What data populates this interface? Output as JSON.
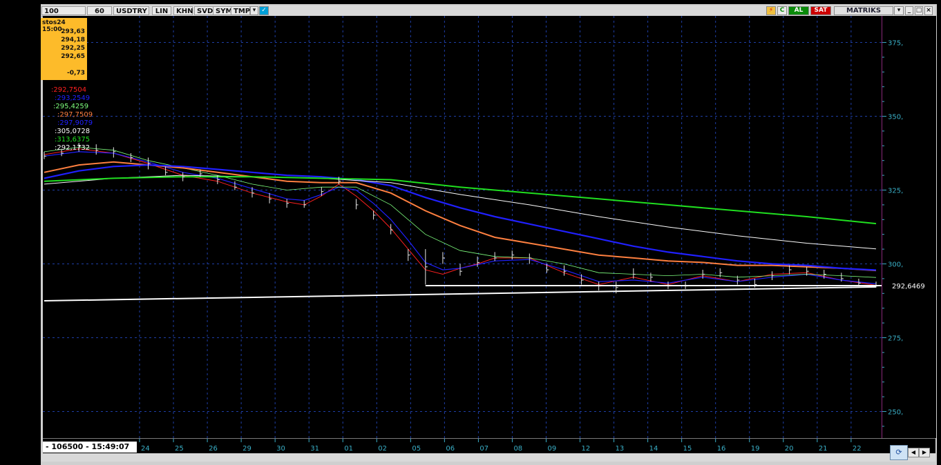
{
  "toolbar": {
    "field_left": "100",
    "period": "60",
    "symbol": "USDTRY",
    "buttons": [
      "LIN",
      "KHN",
      "SVD",
      "SYM",
      "TMP"
    ],
    "al": "AL",
    "sat": "SAT",
    "brand": "MATRIKS",
    "accent": "#00a0d8",
    "al_color": "#0a8a0a",
    "sat_color": "#cc0000"
  },
  "infobox": {
    "title": "stos24 15:00",
    "values": [
      "293,63",
      "294,18",
      "292,25",
      "292,65"
    ],
    "change": "-0,73"
  },
  "legend": [
    {
      "text": ":292,7504",
      "color": "#ff2020"
    },
    {
      "text": ":293,2549",
      "color": "#2020ff"
    },
    {
      "text": ":295,4259",
      "color": "#7fff7f"
    },
    {
      "text": ":297,7509",
      "color": "#ff8040"
    },
    {
      "text": ":297,9079",
      "color": "#2020ff"
    },
    {
      "text": ":305,0728",
      "color": "#ffffff"
    },
    {
      "text": ":313,6375",
      "color": "#20e020"
    },
    {
      "text": ":292,1732",
      "color": "#ffffff"
    }
  ],
  "status": "- 106500 - 15:49:07",
  "last_price_label": "292,6469",
  "chart_data": {
    "type": "line",
    "title": "",
    "xlabel": "",
    "ylabel": "",
    "ylim": [
      241,
      384
    ],
    "yticks": [
      375,
      350,
      325,
      300,
      275,
      250
    ],
    "ytick_labels": [
      "375,",
      "350,",
      "325,",
      "300,",
      "275,",
      "250,"
    ],
    "x_labels": [
      "24",
      "25",
      "26",
      "29",
      "30",
      "31",
      "01",
      "02",
      "05",
      "06",
      "07",
      "08",
      "09",
      "12",
      "13",
      "14",
      "15",
      "16",
      "19",
      "20",
      "21",
      "22"
    ],
    "grid": true,
    "last_price": 292.6469,
    "price_bars": [
      [
        0,
        336.5,
        338,
        335.5
      ],
      [
        0.5,
        337.5,
        339,
        336.5
      ],
      [
        1,
        340,
        341,
        338
      ],
      [
        1.5,
        338.5,
        340.5,
        337
      ],
      [
        2,
        338,
        339.5,
        336
      ],
      [
        2.5,
        336,
        337.5,
        334.5
      ],
      [
        3,
        334,
        336,
        332
      ],
      [
        3.5,
        331,
        333,
        330
      ],
      [
        4,
        329.5,
        331,
        328
      ],
      [
        4.5,
        330.5,
        332,
        329.5
      ],
      [
        5,
        328.5,
        330,
        327
      ],
      [
        5.5,
        326,
        328,
        325
      ],
      [
        6,
        324,
        326,
        322.5
      ],
      [
        6.5,
        322,
        324,
        320.5
      ],
      [
        7,
        320.5,
        322,
        319
      ],
      [
        7.5,
        320,
        321.5,
        319
      ],
      [
        8,
        324.5,
        326,
        323
      ],
      [
        8.5,
        328,
        329.5,
        327
      ],
      [
        9,
        320,
        322,
        318.5
      ],
      [
        9.5,
        316.5,
        318,
        315
      ],
      [
        10,
        311.5,
        313.5,
        310
      ],
      [
        10.5,
        303,
        305,
        301
      ],
      [
        11,
        299,
        305,
        293
      ],
      [
        11.5,
        302,
        304,
        300
      ],
      [
        12,
        297.5,
        300,
        296
      ],
      [
        12.5,
        300.5,
        302.5,
        299
      ],
      [
        13,
        302,
        304,
        301
      ],
      [
        13.5,
        303,
        304.5,
        301.5
      ],
      [
        14,
        302,
        303.5,
        300
      ],
      [
        14.5,
        298,
        300,
        297
      ],
      [
        15,
        297.5,
        299.5,
        296
      ],
      [
        15.5,
        294.5,
        296.5,
        293
      ],
      [
        16,
        292.5,
        294,
        291
      ],
      [
        16.5,
        292,
        294,
        290
      ],
      [
        17,
        296.5,
        298.5,
        295
      ],
      [
        17.5,
        295.5,
        297,
        294
      ],
      [
        18,
        292.5,
        294,
        291.5
      ],
      [
        18.5,
        292.5,
        294,
        291.5
      ],
      [
        19,
        296.5,
        298,
        295
      ],
      [
        19.5,
        297,
        298.5,
        295.5
      ],
      [
        20,
        294.5,
        296,
        293
      ],
      [
        20.5,
        293,
        295,
        292
      ],
      [
        21,
        296,
        297.5,
        294.5
      ],
      [
        21.5,
        298,
        299.5,
        296.5
      ],
      [
        22,
        297.5,
        299,
        296
      ],
      [
        22.5,
        296.5,
        298,
        295
      ],
      [
        23,
        295,
        297,
        294
      ],
      [
        23.5,
        293.5,
        295,
        292.5
      ],
      [
        24,
        292.5,
        294,
        292
      ]
    ],
    "series": [
      {
        "name": "",
        "color": "#ff2020",
        "width": 1,
        "x": [
          0,
          1,
          2,
          3,
          4,
          5,
          6,
          7,
          7.5,
          8,
          8.5,
          9,
          9.5,
          10,
          10.5,
          11,
          11.5,
          12,
          12.5,
          13,
          14,
          15,
          16,
          17,
          18,
          19,
          20,
          21,
          22,
          23,
          24
        ],
        "y": [
          337,
          339,
          337.5,
          334,
          330,
          328,
          324,
          321,
          320,
          323,
          327,
          323,
          318,
          312,
          305,
          298,
          296.5,
          298.5,
          300,
          302,
          302,
          297,
          293,
          295.5,
          293,
          296,
          294,
          296.5,
          297,
          294.5,
          292.75
        ]
      },
      {
        "name": "",
        "color": "#2020ff",
        "width": 1.2,
        "x": [
          0,
          1,
          2,
          3,
          4,
          5,
          6,
          7,
          7.5,
          8,
          8.5,
          9,
          9.5,
          10,
          10.5,
          11,
          11.5,
          12,
          13,
          14,
          15,
          16,
          17,
          18,
          19,
          20,
          21,
          22,
          23,
          24
        ],
        "y": [
          336.5,
          338,
          337.5,
          334.5,
          331,
          329,
          325.5,
          322,
          321.5,
          323.5,
          326,
          325,
          320.5,
          315,
          308,
          300.5,
          298,
          298.5,
          301,
          301.5,
          298,
          294,
          294.5,
          293.5,
          295.5,
          294,
          295.5,
          296.5,
          294.5,
          293.25
        ]
      },
      {
        "name": "",
        "color": "#7fff7f",
        "width": 0.8,
        "x": [
          0,
          1,
          2,
          3,
          4,
          5,
          6,
          7,
          8,
          9,
          10,
          11,
          12,
          13,
          14,
          15,
          16,
          17,
          18,
          19,
          20,
          21,
          22,
          23,
          24
        ],
        "y": [
          338,
          339.5,
          338.5,
          335,
          332.5,
          330,
          327,
          325,
          326,
          326,
          320,
          310,
          304.5,
          302.5,
          302,
          300,
          297,
          296.5,
          296,
          296.5,
          295.5,
          296,
          296.5,
          296,
          295.4
        ]
      },
      {
        "name": "",
        "color": "#ff8040",
        "width": 2,
        "x": [
          0,
          1,
          2,
          3,
          4,
          5,
          6,
          7,
          8,
          9,
          10,
          11,
          12,
          13,
          14,
          15,
          16,
          17,
          18,
          19,
          20,
          21,
          22,
          23,
          24
        ],
        "y": [
          331,
          333.5,
          334.5,
          333.5,
          332.5,
          331,
          329.5,
          328,
          327.5,
          327.5,
          324,
          318,
          313,
          309,
          307,
          305,
          303,
          302,
          301,
          300.5,
          299.5,
          299.5,
          299,
          298.5,
          297.75
        ]
      },
      {
        "name": "",
        "color": "#2020ff",
        "width": 2.2,
        "x": [
          0,
          1,
          2,
          3,
          4,
          5,
          6,
          7,
          8,
          9,
          10,
          11,
          12,
          13,
          14,
          15,
          16,
          17,
          18,
          19,
          20,
          21,
          22,
          23,
          24
        ],
        "y": [
          329,
          331.5,
          333,
          333.5,
          333,
          332,
          331,
          330,
          329.5,
          328.5,
          326.5,
          322.5,
          319,
          316,
          313.5,
          311,
          308.5,
          306,
          304,
          302.5,
          301,
          300,
          299.5,
          298.5,
          297.9
        ]
      },
      {
        "name": "",
        "color": "#ffffff",
        "width": 1,
        "x": [
          0,
          2,
          4,
          6,
          8,
          10,
          12,
          14,
          16,
          18,
          20,
          22,
          24
        ],
        "y": [
          327,
          329,
          330,
          329.5,
          329,
          327.5,
          323.5,
          320,
          316,
          312.5,
          309.5,
          307,
          305.07
        ]
      },
      {
        "name": "",
        "color": "#20e020",
        "width": 2,
        "x": [
          0,
          2,
          4,
          6,
          8,
          10,
          12,
          14,
          16,
          18,
          20,
          22,
          24
        ],
        "y": [
          328,
          329,
          329.5,
          329.5,
          329,
          328.5,
          326,
          324,
          322,
          320,
          318,
          316,
          313.64
        ]
      },
      {
        "name": "",
        "color": "#ffffff",
        "width": 2,
        "x": [
          0,
          24
        ],
        "y": [
          287.5,
          292.2
        ]
      }
    ]
  }
}
